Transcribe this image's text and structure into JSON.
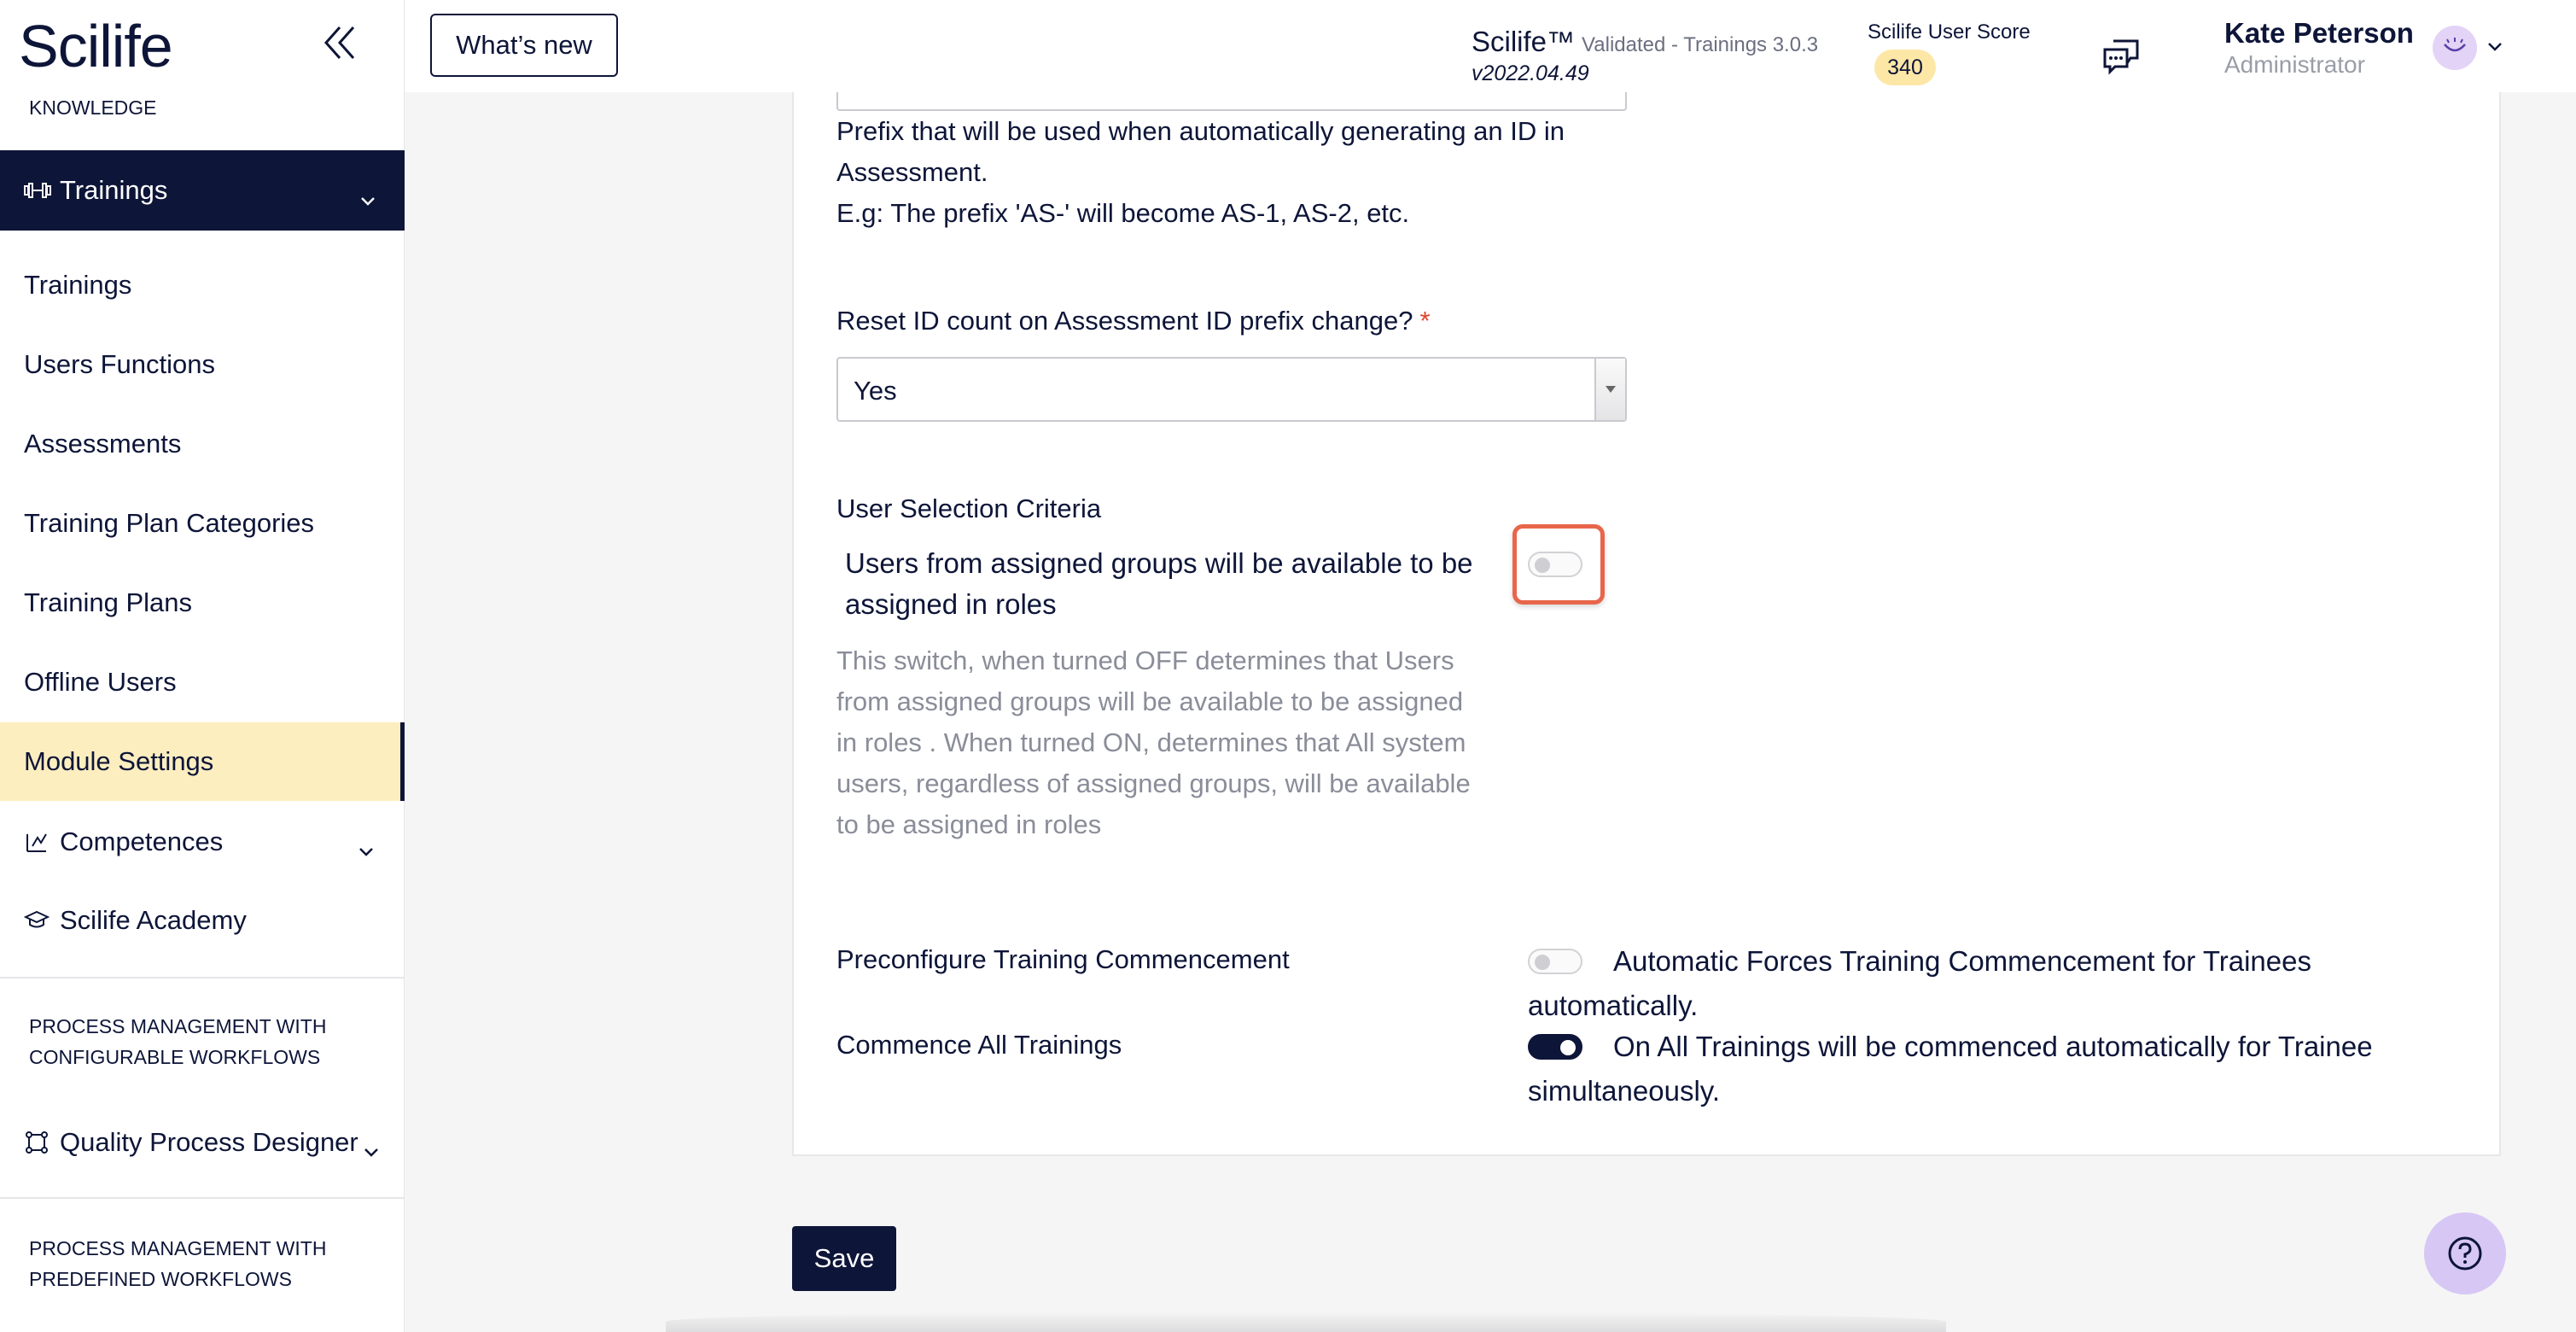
{
  "sidebar": {
    "logo": "Scilife",
    "knowledge_label": "KNOWLEDGE",
    "trainings_group": "Trainings",
    "items": [
      {
        "label": "Trainings"
      },
      {
        "label": "Users Functions"
      },
      {
        "label": "Assessments"
      },
      {
        "label": "Training Plan Categories"
      },
      {
        "label": "Training Plans"
      },
      {
        "label": "Offline Users"
      },
      {
        "label": "Module Settings",
        "active": true
      }
    ],
    "competences": "Competences",
    "academy": "Scilife Academy",
    "configurable_label": "PROCESS MANAGEMENT WITH CONFIGURABLE WORKFLOWS",
    "quality_designer": "Quality Process Designer",
    "predefined_label": "PROCESS MANAGEMENT WITH PREDEFINED WORKFLOWS"
  },
  "topbar": {
    "whats_new": "What’s new",
    "brand": "Scilife™",
    "validated": "Validated - Trainings 3.0.3",
    "version": "v2022.04.49",
    "score_label": "Scilife User Score",
    "score_value": "340",
    "user_name": "Kate Peterson",
    "user_role": "Administrator"
  },
  "form": {
    "prefix_help_1": "Prefix that will be used when automatically generating an ID in Assessment.",
    "prefix_help_2": "E.g: The prefix 'AS-' will become AS-1, AS-2, etc.",
    "reset_label": "Reset ID count on Assessment ID prefix change?",
    "required_mark": "*",
    "reset_value": "Yes",
    "user_selection_label": "User Selection Criteria",
    "user_selection_switch_text": "Users from assigned groups will be available to be assigned in roles",
    "user_selection_switch_on": false,
    "user_selection_help": "This switch, when turned OFF determines that Users from assigned groups will be available to be assigned in roles . When turned ON, determines that All system users, regardless of assigned groups, will be available to be assigned in roles",
    "precommence_label": "Preconfigure Training Commencement",
    "precommence_text": "Automatic Forces Training Commencement for Trainees automatically.",
    "precommence_on": false,
    "commence_all_label": "Commence All Trainings",
    "commence_all_text": "On All Trainings will be commenced automatically for Trainee simultaneously.",
    "commence_all_on": true
  },
  "actions": {
    "save": "Save"
  },
  "colors": {
    "navy": "#0d1538",
    "active_bg": "#fdeec0",
    "highlight": "#e8664a",
    "required": "#e0442c"
  }
}
